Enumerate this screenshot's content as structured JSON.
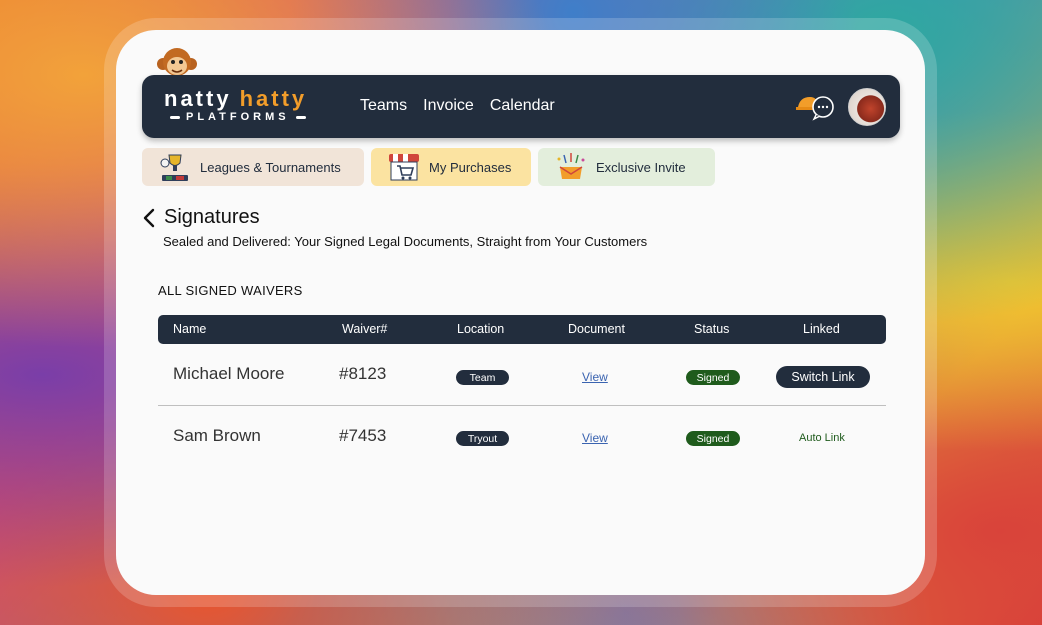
{
  "brand": {
    "word1": "natty",
    "word2": "hatty",
    "tagline": "PLATFORMS"
  },
  "nav": {
    "links": [
      "Teams",
      "Invoice",
      "Calendar"
    ]
  },
  "tabs": [
    {
      "label": "Leagues & Tournaments"
    },
    {
      "label": "My Purchases"
    },
    {
      "label": "Exclusive Invite"
    }
  ],
  "page": {
    "title": "Signatures",
    "subtitle": "Sealed and Delivered: Your Signed Legal Documents, Straight from Your Customers",
    "section_label": "ALL SIGNED WAIVERS"
  },
  "table": {
    "columns": [
      "Name",
      "Waiver#",
      "Location",
      "Document",
      "Status",
      "Linked"
    ],
    "rows": [
      {
        "name": "Michael Moore",
        "waiver": "#8123",
        "location": "Team",
        "document": "View",
        "status": "Signed",
        "linked": "Switch Link"
      },
      {
        "name": "Sam Brown",
        "waiver": "#7453",
        "location": "Tryout",
        "document": "View",
        "status": "Signed",
        "linked": "Auto Link"
      }
    ]
  },
  "colors": {
    "navbar": "#222d3d",
    "accent_orange": "#f29d2a",
    "signed_green": "#1f5b1c",
    "link_blue": "#3a63b0"
  }
}
